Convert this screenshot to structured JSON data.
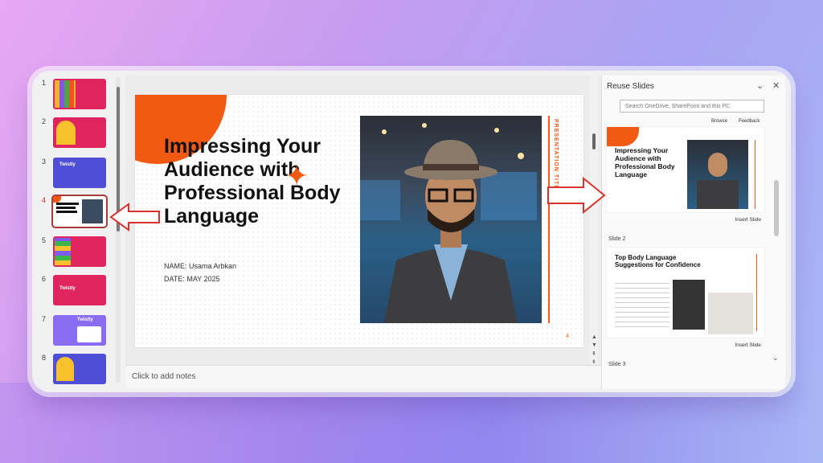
{
  "thumbnails": [
    {
      "num": "1",
      "title": "",
      "color": "#e0245e"
    },
    {
      "num": "2",
      "title": "",
      "color": "#e0245e"
    },
    {
      "num": "3",
      "title": "Twistly",
      "color": "#6a4fe0"
    },
    {
      "num": "4",
      "title": "",
      "color": "#ffffff"
    },
    {
      "num": "5",
      "title": "",
      "color": "#e0245e"
    },
    {
      "num": "6",
      "title": "Twistly",
      "color": "#e0245e"
    },
    {
      "num": "7",
      "title": "Twistly",
      "color": "#7c5cf0"
    },
    {
      "num": "8",
      "title": "",
      "color": "#6a4fe0"
    }
  ],
  "slide": {
    "title": "Impressing Your Audience with Professional Body Language",
    "name_line": "NAME: Usama Arbkan",
    "date_line": "DATE: MAY 2025",
    "vertical_title": "PRESENTATION TITLE",
    "page_number": "4",
    "accent": "#f25a14"
  },
  "notes_placeholder": "Click to add notes",
  "reuse_panel": {
    "title": "Reuse Slides",
    "search_placeholder": "Search OneDrive, SharePoint and this PC",
    "browse": "Browse",
    "feedback": "Feedback",
    "slide1_title": "Impressing Your Audience with Professional Body Language",
    "slide2_label": "Slide 2",
    "slide2_title": "Top Body Language Suggestions for Confidence",
    "slide3_label": "Slide 3",
    "insert_label": "Insert Slide"
  }
}
